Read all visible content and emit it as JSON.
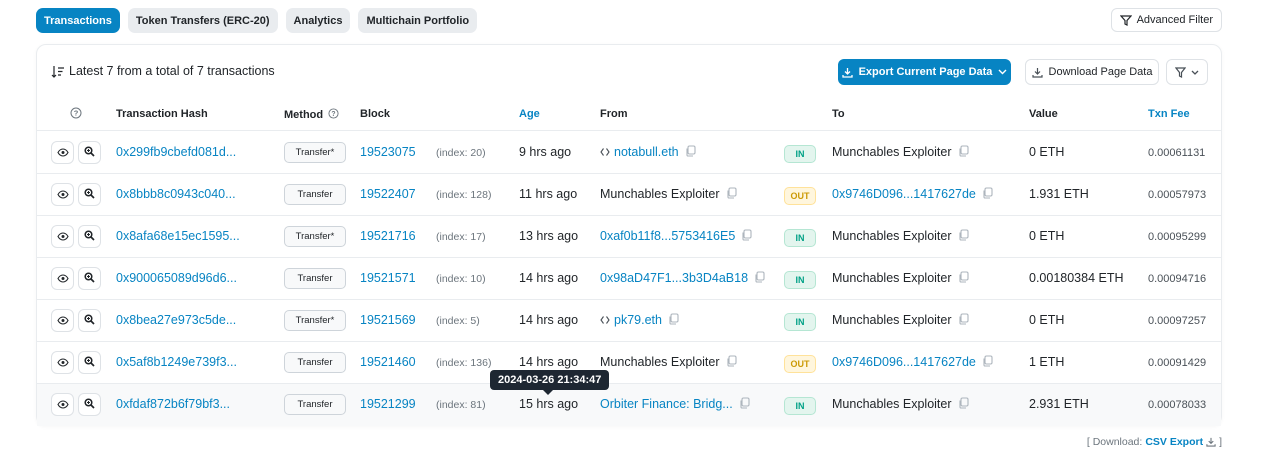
{
  "tabs": [
    "Transactions",
    "Token Transfers (ERC-20)",
    "Analytics",
    "Multichain Portfolio"
  ],
  "advanced_filter_label": "Advanced Filter",
  "summary": "Latest 7 from a total of 7 transactions",
  "export_label": "Export Current Page Data",
  "download_label": "Download Page Data",
  "columns": {
    "hash": "Transaction Hash",
    "method": "Method",
    "block": "Block",
    "age": "Age",
    "from": "From",
    "to": "To",
    "value": "Value",
    "fee": "Txn Fee"
  },
  "rows": [
    {
      "hash": "0x299fb9cbefd081d...",
      "method": "Transfer*",
      "block": "19523075",
      "index": "(index: 20)",
      "age": "9 hrs ago",
      "from": "notabull.eth",
      "from_link": true,
      "from_ens": true,
      "dir": "IN",
      "to": "Munchables Exploiter",
      "to_link": false,
      "value": "0 ETH",
      "fee": "0.00061131"
    },
    {
      "hash": "0x8bbb8c0943c040...",
      "method": "Transfer",
      "block": "19522407",
      "index": "(index: 128)",
      "age": "11 hrs ago",
      "from": "Munchables Exploiter",
      "from_link": false,
      "from_ens": false,
      "dir": "OUT",
      "to": "0x9746D096...1417627de",
      "to_link": true,
      "value": "1.931 ETH",
      "fee": "0.00057973"
    },
    {
      "hash": "0x8afa68e15ec1595...",
      "method": "Transfer*",
      "block": "19521716",
      "index": "(index: 17)",
      "age": "13 hrs ago",
      "from": "0xaf0b11f8...5753416E5",
      "from_link": true,
      "from_ens": false,
      "dir": "IN",
      "to": "Munchables Exploiter",
      "to_link": false,
      "value": "0 ETH",
      "fee": "0.00095299"
    },
    {
      "hash": "0x900065089d96d6...",
      "method": "Transfer",
      "block": "19521571",
      "index": "(index: 10)",
      "age": "14 hrs ago",
      "from": "0x98aD47F1...3b3D4aB18",
      "from_link": true,
      "from_ens": false,
      "dir": "IN",
      "to": "Munchables Exploiter",
      "to_link": false,
      "value": "0.00180384 ETH",
      "fee": "0.00094716"
    },
    {
      "hash": "0x8bea27e973c5de...",
      "method": "Transfer*",
      "block": "19521569",
      "index": "(index: 5)",
      "age": "14 hrs ago",
      "from": "pk79.eth",
      "from_link": true,
      "from_ens": true,
      "dir": "IN",
      "to": "Munchables Exploiter",
      "to_link": false,
      "value": "0 ETH",
      "fee": "0.00097257"
    },
    {
      "hash": "0x5af8b1249e739f3...",
      "method": "Transfer",
      "block": "19521460",
      "index": "(index: 136)",
      "age": "14 hrs ago",
      "from": "Munchables Exploiter",
      "from_link": false,
      "from_ens": false,
      "dir": "OUT",
      "to": "0x9746D096...1417627de",
      "to_link": true,
      "value": "1 ETH",
      "fee": "0.00091429"
    },
    {
      "hash": "0xfdaf872b6f79bf3...",
      "method": "Transfer",
      "block": "19521299",
      "index": "(index: 81)",
      "age": "15 hrs ago",
      "from": "Orbiter Finance: Bridg...",
      "from_link": true,
      "from_ens": false,
      "dir": "IN",
      "to": "Munchables Exploiter",
      "to_link": false,
      "value": "2.931 ETH",
      "fee": "0.00078033"
    }
  ],
  "tooltip": "2024-03-26 21:34:47",
  "csv": {
    "prefix": "[ Download:",
    "link": "CSV Export",
    "suffix": "]"
  }
}
